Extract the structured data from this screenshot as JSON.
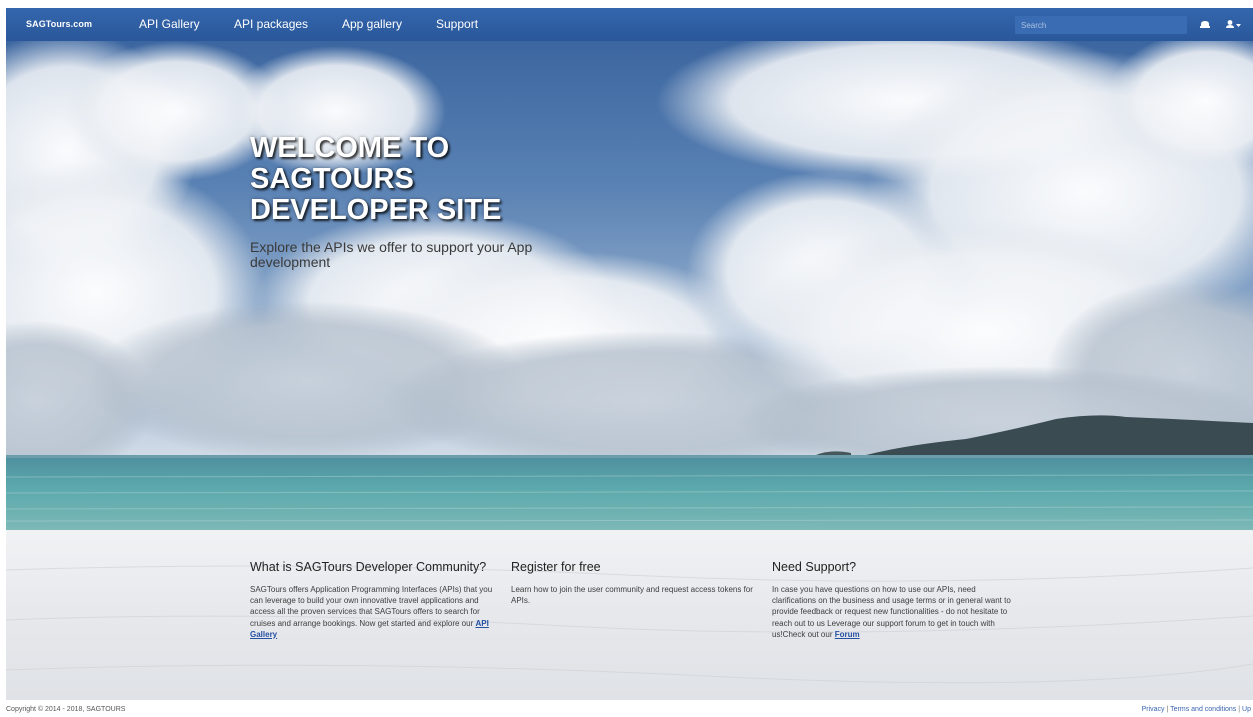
{
  "nav": {
    "brand": "SAGTours.com",
    "links": [
      "API Gallery",
      "API packages",
      "App gallery",
      "Support"
    ],
    "search_placeholder": "Search",
    "icons": [
      "cloud-icon",
      "user-icon",
      "caret-down-icon"
    ]
  },
  "hero": {
    "title": "WELCOME TO\nSAGTOURS\nDEVELOPER SITE",
    "subtitle": "Explore the APIs we offer to support your App development"
  },
  "features": [
    {
      "title": "What is SAGTours Developer Community?",
      "text": "SAGTours offers Application Programming Interfaces (APIs) that you can leverage to build your own innovative travel applications and access all the proven services that SAGTours offers to search for cruises and arrange bookings. Now get started and explore our",
      "link": "API Gallery"
    },
    {
      "title": "Register for free",
      "text": "Learn how to join the user community and request access tokens for APIs.",
      "link": ""
    },
    {
      "title": "Need Support?",
      "text": "In case you have questions on how to use our APIs, need clarifications on the business and usage terms or in general want to provide feedback or request new functionalities - do not hesitate to reach out to us Leverage our support forum to get in touch with us!Check out our",
      "link": "Forum"
    }
  ],
  "footer": {
    "copyright": "Copyright © 2014 - 2018, SAGTOURS",
    "links": [
      "Privacy",
      "Terms and conditions",
      "Up"
    ],
    "separator": "|"
  },
  "colors": {
    "navbar": "#2c5aa0",
    "link": "#2450a3",
    "sky": "#4f78a8",
    "sea": "#5a9ea4"
  }
}
